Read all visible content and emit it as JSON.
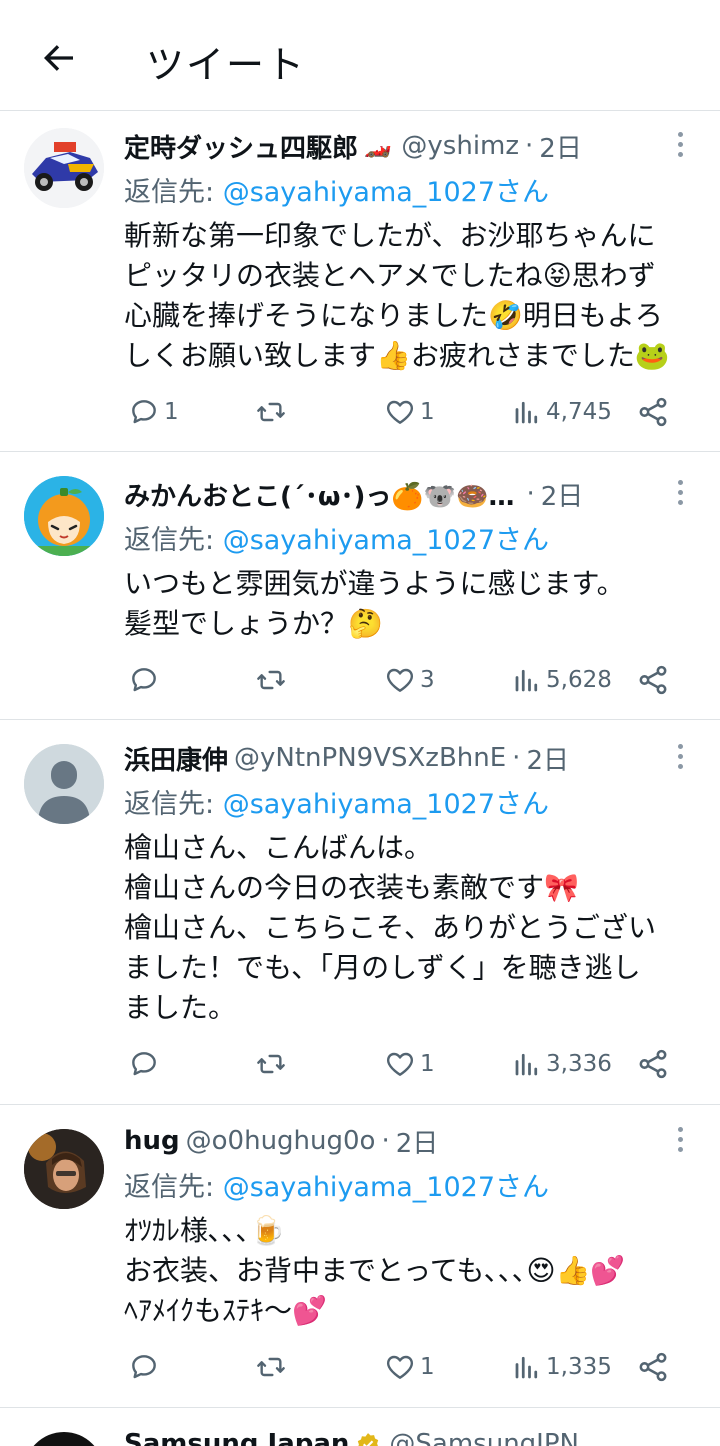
{
  "header": {
    "title": "ツイート"
  },
  "reply_prefix": "返信先: ",
  "tweets": [
    {
      "name": "定時ダッシュ四駆郎",
      "name_emoji": "🏎️",
      "handle": "@yshimz",
      "sep": "·",
      "time": "2日",
      "reply_to": "@sayahiyama_1027さん",
      "lines": [
        "斬新な第一印象でしたが、お沙耶ちゃんに",
        "ピッタリの衣装とヘアメでしたね😝思わず",
        "心臓を捧げそうになりました🤣明日もよろ",
        "しくお願い致します👍お疲れさまでした🐸"
      ],
      "replies": "1",
      "retweets": "",
      "likes": "1",
      "views": "4,745"
    },
    {
      "name": "みかんおとこ(´･ω･)っ🍊🐨🍩…",
      "name_emoji": "",
      "handle": "",
      "sep": "·",
      "time": "2日",
      "reply_to": "@sayahiyama_1027さん",
      "lines": [
        "いつもと雰囲気が違うように感じます。",
        "髪型でしょうか？🤔"
      ],
      "replies": "",
      "retweets": "",
      "likes": "3",
      "views": "5,628"
    },
    {
      "name": "浜田康伸",
      "name_emoji": "",
      "handle": "@yNtnPN9VSXzBhnE",
      "sep": "·",
      "time": "2日",
      "reply_to": "@sayahiyama_1027さん",
      "lines": [
        "檜山さん、こんばんは。",
        "檜山さんの今日の衣装も素敵です🎀",
        "檜山さん、こちらこそ、ありがとうござい",
        "ました！でも、「月のしずく」を聴き逃し",
        "ました。"
      ],
      "replies": "",
      "retweets": "",
      "likes": "1",
      "views": "3,336"
    },
    {
      "name": "hug",
      "name_emoji": "",
      "handle": "@o0hughug0o",
      "sep": "·",
      "time": "2日",
      "reply_to": "@sayahiyama_1027さん",
      "lines": [
        "ｵﾂｶﾚ様､､､🍺",
        "お衣装、お背中までとっても､､､😍👍💕",
        "ﾍｱﾒｲｸもｽﾃｷ〜💕"
      ],
      "replies": "",
      "retweets": "",
      "likes": "1",
      "views": "1,335"
    },
    {
      "name": "Samsung Japan",
      "handle": "@SamsungJPN"
    }
  ],
  "colors": {
    "link": "#1d9bf0",
    "secondary": "#536471",
    "divider": "#dfe3e6"
  }
}
